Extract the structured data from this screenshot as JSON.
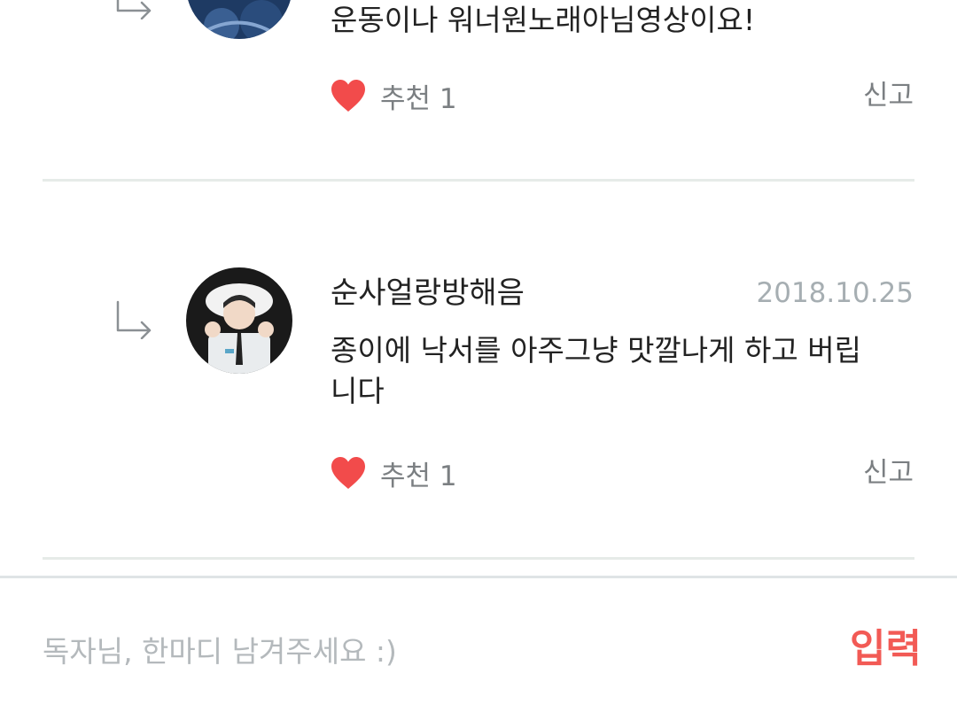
{
  "comments": [
    {
      "username": "",
      "date": "",
      "text": "운동이나 워너원노래아님영상이요!",
      "like_label": "추천 1",
      "report_label": "신고",
      "avatar_icon": "user-avatar"
    },
    {
      "username": "순사얼랑방해음",
      "date": "2018.10.25",
      "text": "종이에 낙서를 아주그냥 맛깔나게 하고 버립니다",
      "like_label": "추천 1",
      "report_label": "신고",
      "avatar_icon": "user-avatar"
    }
  ],
  "input": {
    "placeholder": "독자님, 한마디 남겨주세요 :)",
    "value": "",
    "submit_label": "입력"
  },
  "colors": {
    "heart": "#f24b4b",
    "accent": "#f25a55",
    "muted_text": "#a6aeb2",
    "divider": "#e6ebe8"
  }
}
